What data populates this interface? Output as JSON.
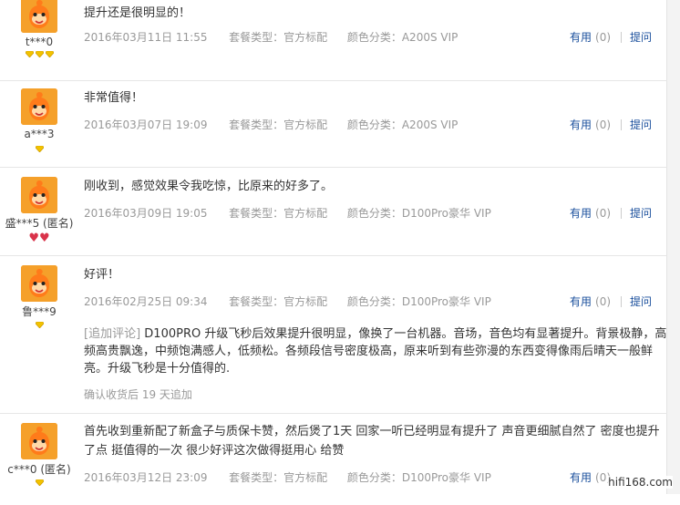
{
  "colors": {
    "link": "#1a4f9c",
    "muted": "#999999",
    "avatar_bg": "#f5a02a",
    "gem": "#f2c200",
    "heart": "#d9334a"
  },
  "reviews": [
    {
      "text": "提升还是很明显的！",
      "user": "t***0",
      "badge_icon": "gold-diamond-icon",
      "badge_count": 3,
      "date": "2016年03月11日 11:55",
      "package_label": "套餐类型：",
      "package": "官方标配",
      "color_label": "颜色分类：",
      "color": "A200S VIP",
      "useful_label": "有用",
      "useful_count": "(0)",
      "ask_label": "提问"
    },
    {
      "text": "非常值得！",
      "user": "a***3",
      "badge_icon": "gold-diamond-icon",
      "badge_count": 1,
      "date": "2016年03月07日 19:09",
      "package_label": "套餐类型：",
      "package": "官方标配",
      "color_label": "颜色分类：",
      "color": "A200S VIP",
      "useful_label": "有用",
      "useful_count": "(0)",
      "ask_label": "提问"
    },
    {
      "text": "刚收到，感觉效果令我吃惊，比原来的好多了。",
      "user": "盛***5 (匿名)",
      "badge_icon": "red-heart-icon",
      "badge_count": 2,
      "date": "2016年03月09日 19:05",
      "package_label": "套餐类型：",
      "package": "官方标配",
      "color_label": "颜色分类：",
      "color": "D100Pro豪华 VIP",
      "useful_label": "有用",
      "useful_count": "(0)",
      "ask_label": "提问"
    },
    {
      "text": "好评！",
      "user": "鲁***9",
      "badge_icon": "gold-diamond-icon",
      "badge_count": 1,
      "date": "2016年02月25日 09:34",
      "package_label": "套餐类型：",
      "package": "官方标配",
      "color_label": "颜色分类：",
      "color": "D100Pro豪华 VIP",
      "useful_label": "有用",
      "useful_count": "(0)",
      "ask_label": "提问",
      "append_label": "[追加评论]",
      "append_text": "D100PRO 升级飞秒后效果提升很明显，像换了一台机器。音场，音色均有显著提升。背景极静，高频高贵飘逸，中频饱满感人，低频松。各频段信号密度极高，原来听到有些弥漫的东西变得像雨后晴天一般鲜亮。升级飞秒是十分值得的.",
      "append_foot": "确认收货后 19 天追加"
    },
    {
      "text": "首先收到重新配了新盒子与质保卡赞，然后煲了1天 回家一听已经明显有提升了 声音更细腻自然了 密度也提升了点 挺值得的一次 很少好评这次做得挺用心 给赞",
      "user": "c***0 (匿名)",
      "badge_icon": "gold-diamond-icon",
      "badge_count": 1,
      "date": "2016年03月12日 23:09",
      "package_label": "套餐类型：",
      "package": "官方标配",
      "color_label": "颜色分类：",
      "color": "D100Pro豪华 VIP",
      "useful_label": "有用",
      "useful_count": "(0)",
      "ask_label": "提问"
    }
  ],
  "watermark": "hifi168.com"
}
